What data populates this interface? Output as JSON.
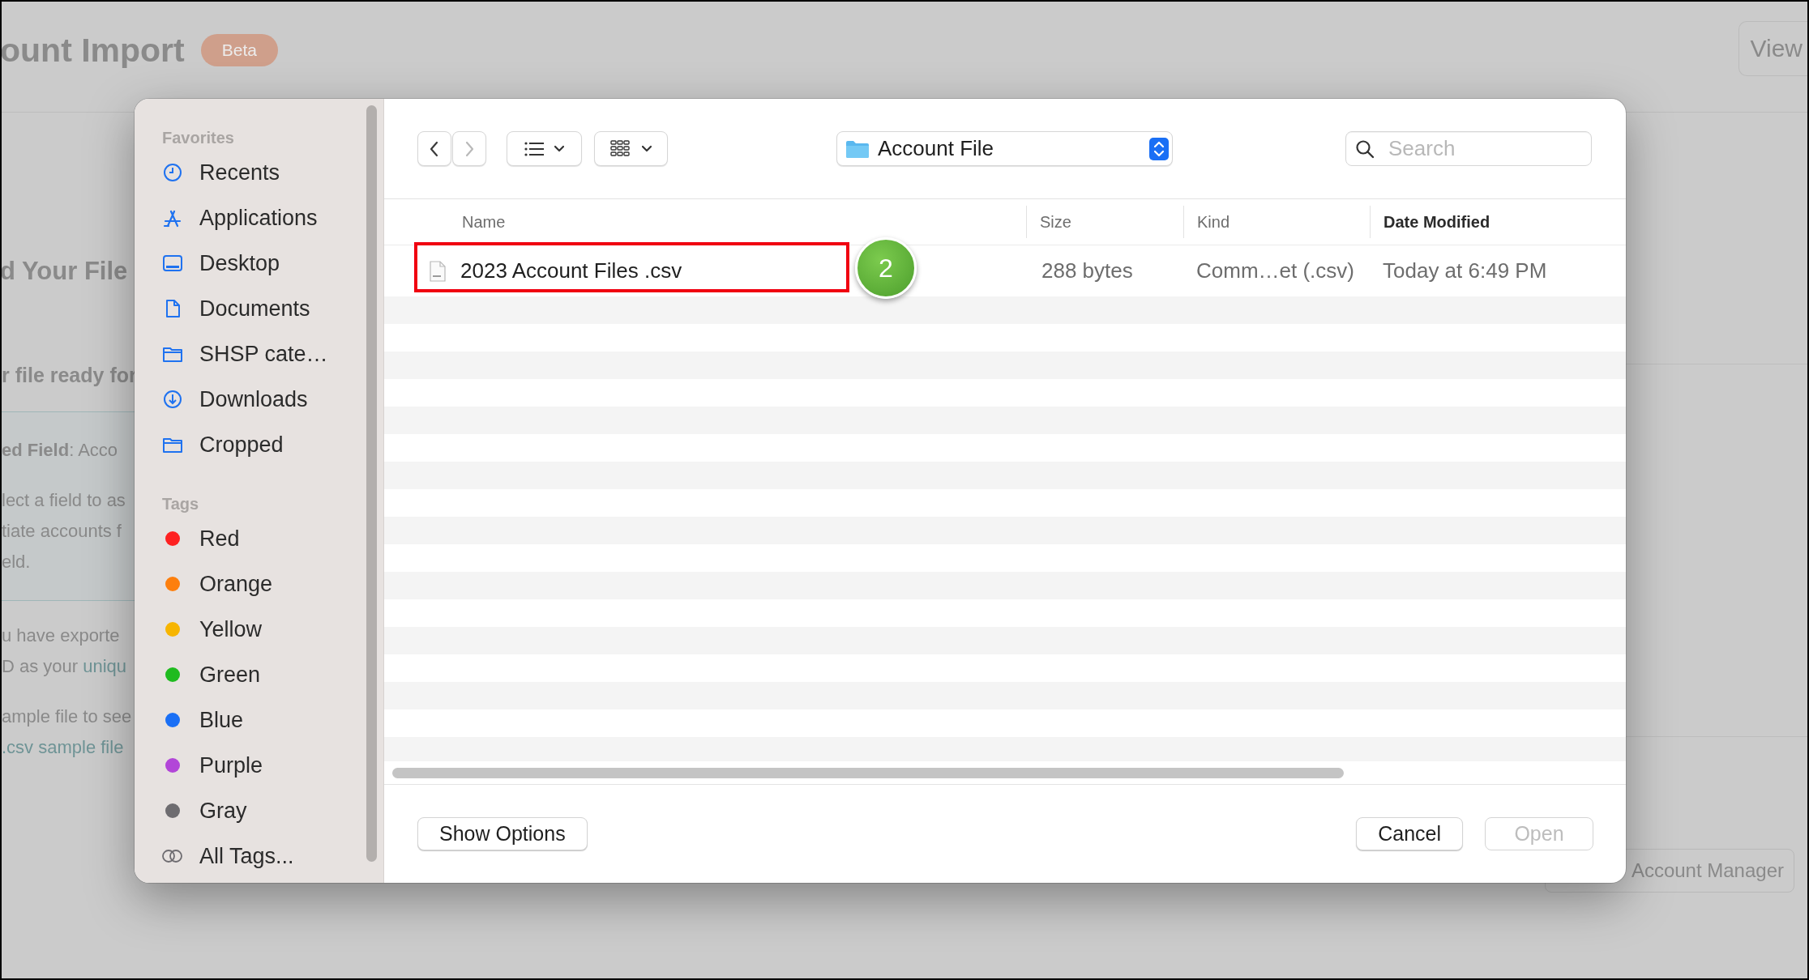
{
  "background_page": {
    "title": "ount Import",
    "badge": "Beta",
    "view_button": "View",
    "heading": "d Your File",
    "subheading": "r file ready for",
    "info_box": {
      "lines": [
        "**ed Field**: Acco",
        "lect a field to as",
        "tiate accounts f",
        "eld."
      ]
    },
    "paragraphs": [
      {
        "lines": [
          {
            "text": "u have exporte"
          },
          {
            "text": "D as your ",
            "link": "uniqu"
          }
        ]
      },
      {
        "lines": [
          {
            "text": "ample file to see"
          },
          {
            "link": ".csv sample file"
          }
        ]
      }
    ],
    "account_manager_button": "Account Manager"
  },
  "dialog": {
    "sidebar": {
      "sections": [
        {
          "title": "Favorites",
          "items": [
            {
              "label": "Recents",
              "kind": "place"
            },
            {
              "label": "Applications",
              "kind": "place"
            },
            {
              "label": "Desktop",
              "kind": "place"
            },
            {
              "label": "Documents",
              "kind": "place"
            },
            {
              "label": "SHSP cate…",
              "kind": "place"
            },
            {
              "label": "Downloads",
              "kind": "place"
            },
            {
              "label": "Cropped",
              "kind": "place"
            }
          ]
        },
        {
          "title": "Tags",
          "items": [
            {
              "label": "Red",
              "kind": "tag",
              "color": "#fe2121"
            },
            {
              "label": "Orange",
              "kind": "tag",
              "color": "#fd7f0d"
            },
            {
              "label": "Yellow",
              "kind": "tag",
              "color": "#f7b500"
            },
            {
              "label": "Green",
              "kind": "tag",
              "color": "#1fbb1f"
            },
            {
              "label": "Blue",
              "kind": "tag",
              "color": "#1a6ff5"
            },
            {
              "label": "Purple",
              "kind": "tag",
              "color": "#b246d8"
            },
            {
              "label": "Gray",
              "kind": "tag",
              "color": "#6e6c70"
            },
            {
              "label": "All Tags...",
              "kind": "all-tags"
            }
          ]
        }
      ]
    },
    "toolbar": {
      "nav_buttons": [
        {
          "kind": "back",
          "disabled": false
        },
        {
          "kind": "forward",
          "disabled": true
        }
      ],
      "location": "Account File",
      "search": {
        "placeholder": "Search"
      }
    },
    "file_list": {
      "columns": [
        {
          "label": "Name",
          "sorted": false
        },
        {
          "label": "Size",
          "sorted": false
        },
        {
          "label": "Kind",
          "sorted": false
        },
        {
          "label": "Date Modified",
          "sorted": true
        }
      ],
      "rows": [
        {
          "name": "2023 Account Files .csv",
          "size": "288 bytes",
          "file_kind": "Comm…et (.csv)",
          "date": "Today at 6:49 PM",
          "highlighted": true,
          "step_badge": "2"
        }
      ]
    },
    "footer": {
      "options_button": "Show Options",
      "buttons": [
        {
          "label": "Cancel",
          "disabled": false
        },
        {
          "label": "Open",
          "disabled": true
        }
      ]
    }
  }
}
